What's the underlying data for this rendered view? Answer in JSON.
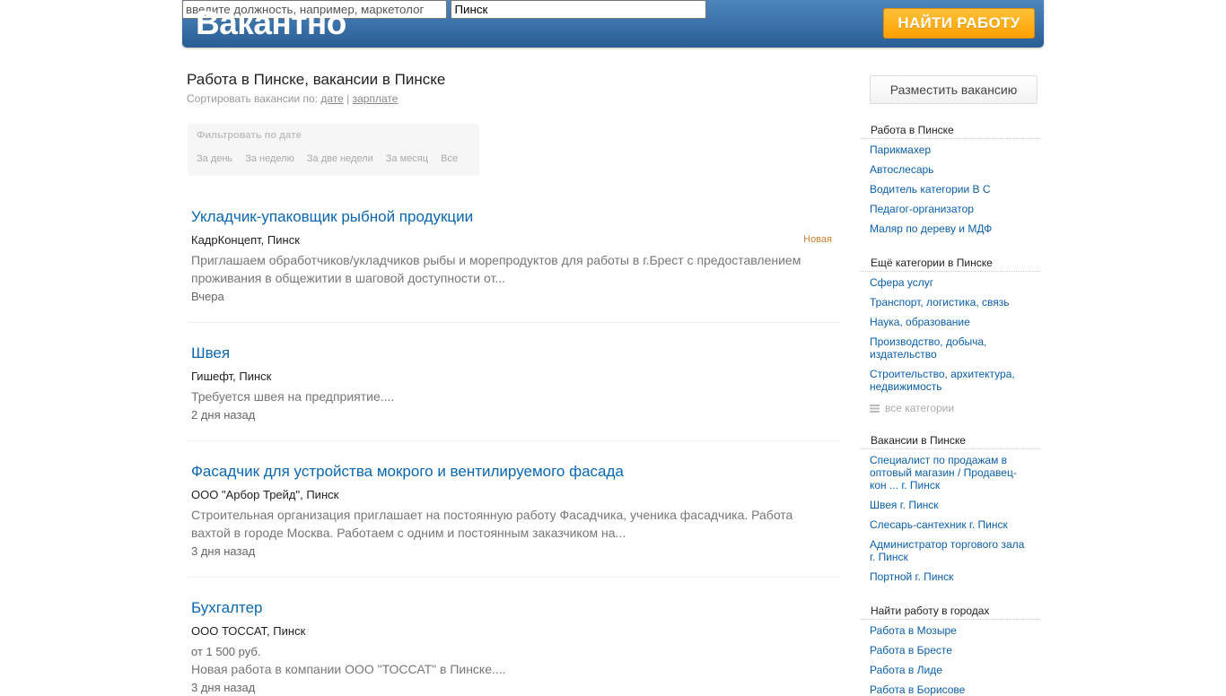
{
  "header": {
    "logo": "Вакантно",
    "search_placeholder": "введите должность, например, маркетолог",
    "city_value": "Пинск",
    "find_label": "НАЙТИ РАБОТУ"
  },
  "main": {
    "title": "Работа в Пинске, вакансии в Пинске",
    "sort_prefix": "Сортировать вакансии по:",
    "sort_date": "дате",
    "sort_separator": "|",
    "sort_salary": "зарплате",
    "filter_title": "Фильтровать по дате",
    "filters": [
      "За день",
      "За неделю",
      "За две недели",
      "За месяц",
      "Все"
    ]
  },
  "vacancies": [
    {
      "title": "Укладчик-упаковщик рыбной продукции",
      "company": "КадрКонцепт, Пинск",
      "badge": "Новая",
      "description": "Приглашаем обработчиков/укладчиков рыбы и морепродуктов для работы в г.Брест с предоставлением проживания в общежитии в шаговой доступности от...",
      "date": "Вчера"
    },
    {
      "title": "Швея",
      "company": "Гишефт, Пинск",
      "description": "Требуется швея на предприятие....",
      "date": "2 дня назад"
    },
    {
      "title": "Фасадчик для устройства мокрого и вентилируемого фасада",
      "company": "ООО \"Арбор Трейд\", Пинск",
      "description": "Строительная организация приглашает на постоянную работу Фасадчика, ученика фасадчика. Работа вахтой в городе Москва. Работаем с одним и постоянным заказчиком на...",
      "date": "3 дня назад"
    },
    {
      "title": "Бухгалтер",
      "company": "ООО ТОССАТ, Пинск",
      "salary": "от 1 500 руб.",
      "description": "Новая работа в компании ООО \"ТОССАТ\" в Пинске....",
      "date": "3 дня назад"
    }
  ],
  "sidebar": {
    "post_vacancy": "Разместить вакансию",
    "work_head": "Работа в Пинске",
    "work_links": [
      "Парикмахер",
      "Автослесарь",
      "Водитель категории В С",
      "Педагог-организатор",
      "Маляр по дереву и МДФ"
    ],
    "more_head": "Ещё категории в Пинске",
    "more_links": [
      "Сфера услуг",
      "Транспорт, логистика, связь",
      "Наука, образование",
      "Производство, добыча, издательство",
      "Строительство, архитектура, недвижимость"
    ],
    "all_categories": "все категории",
    "vac_head": "Вакансии в Пинске",
    "vac_links": [
      "Специалист по продажам в оптовый магазин / Продавец-кон ... г. Пинск",
      "Швея г. Пинск",
      "Слесарь-сантехник г. Пинск",
      "Администратор торгового зала г. Пинск",
      "Портной г. Пинск"
    ],
    "cities_head": "Найти работу в городах",
    "cities_links": [
      "Работа в Мозыре",
      "Работа в Бресте",
      "Работа в Лиде",
      "Работа в Борисове"
    ]
  }
}
